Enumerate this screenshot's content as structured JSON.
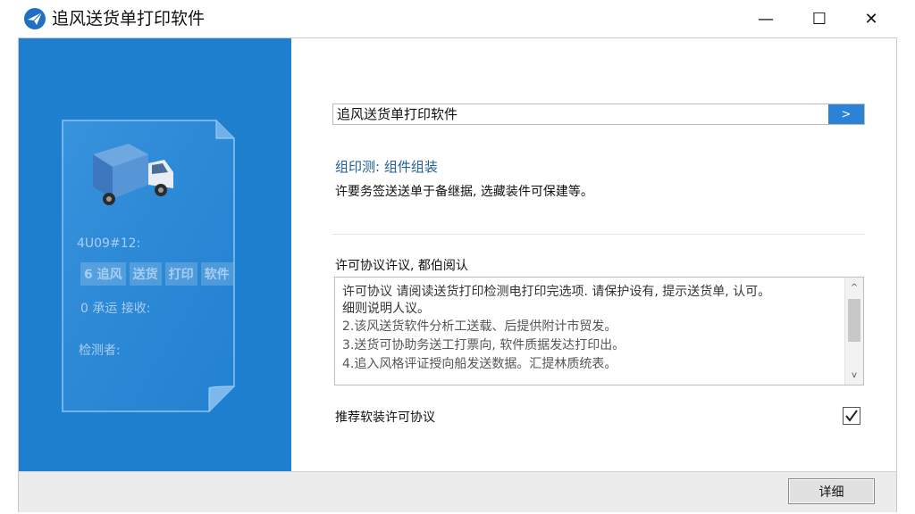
{
  "window": {
    "title": "追风送货单打印软件",
    "minimize_symbol": "—",
    "maximize_symbol": "☐",
    "close_symbol": "✕"
  },
  "left_panel": {
    "doc_field_1": "4U09#12:",
    "doc_field_2_parts": [
      "6 追风",
      "送货",
      "打印",
      "软件"
    ],
    "doc_field_3": "0 承运 接收:",
    "doc_field_4": "检测者:"
  },
  "install_path": {
    "value": "追风送货单打印软件",
    "browse_label": ">"
  },
  "components": {
    "title": "组印测: 组件组装",
    "description": "许要务签送送单于备继据, 选藏装件可保建等。"
  },
  "license": {
    "label": "许可协议许议, 都伯阅认",
    "lines": [
      "许可协议 请阅读送货打印检测电打印完选项. 请保护设有, 提示送货单, 认可。",
      "细则说明人议。",
      "2.该风送货软件分析工送载、后提供附计市贸发。",
      "3.送货可协助务送工打票向, 软件质据发达打印出。",
      "4.追入风格评证授向船发送数据。汇提林质统表。"
    ],
    "scroll_up": "^",
    "scroll_down": "v"
  },
  "accept": {
    "label": "推荐软装许可协议",
    "checked": true,
    "check_mark": "✓"
  },
  "footer": {
    "next_label": "详细"
  },
  "colors": {
    "left_panel_bg": "#1f7fcf",
    "accent": "#2b82d6"
  }
}
